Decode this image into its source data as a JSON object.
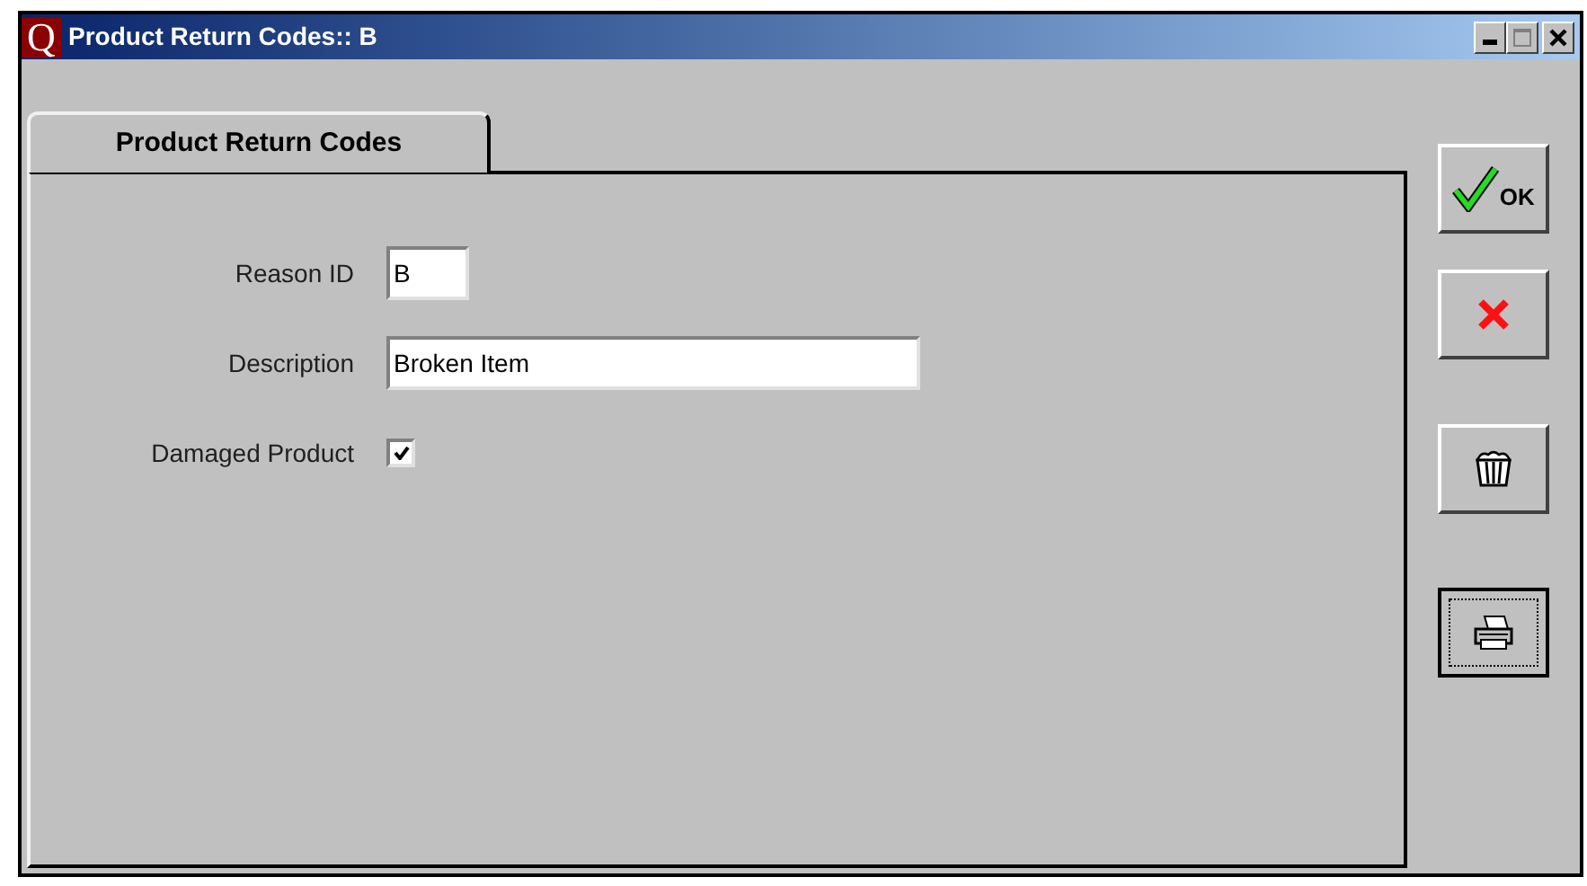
{
  "window": {
    "logo": "Q",
    "title": "Product Return Codes:: B"
  },
  "tabs": [
    {
      "label": "Product Return Codes",
      "selected": true
    }
  ],
  "fields": [
    {
      "kind": "code",
      "label": "Reason ID",
      "value": "B"
    },
    {
      "kind": "text",
      "label": "Description",
      "value": "Broken Item"
    },
    {
      "kind": "checkbox",
      "label": "Damaged Product",
      "checked": true
    }
  ],
  "buttons": [
    {
      "kind": "ok",
      "label": "OK",
      "focused": false
    },
    {
      "kind": "cancel",
      "focused": false
    },
    {
      "kind": "delete",
      "focused": false
    },
    {
      "kind": "print",
      "focused": true
    }
  ]
}
